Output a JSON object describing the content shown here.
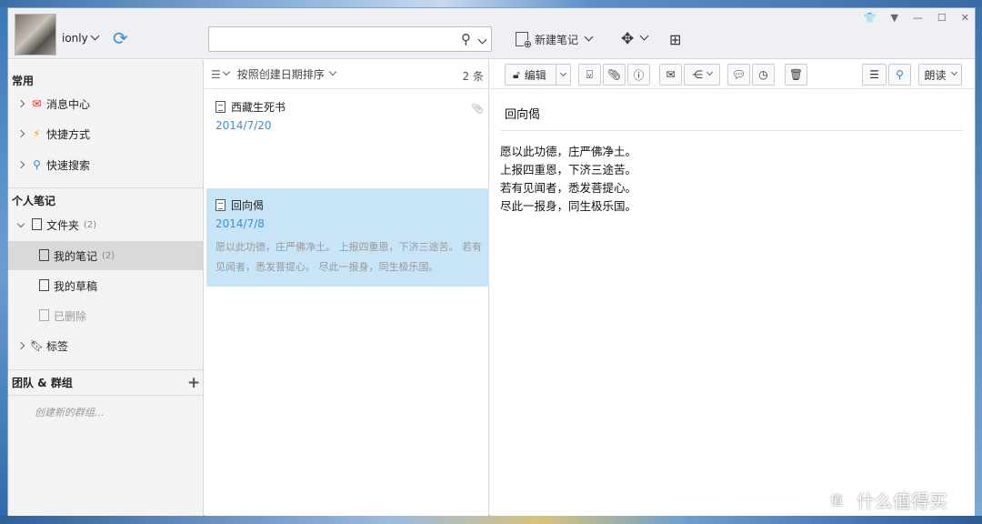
{
  "user": {
    "name": "ionly"
  },
  "toolbar": {
    "new_note_label": "新建笔记"
  },
  "search": {
    "placeholder": ""
  },
  "sidebar": {
    "common_label": "常用",
    "common_items": [
      {
        "label": "消息中心",
        "icon": "message-icon"
      },
      {
        "label": "快捷方式",
        "icon": "lightning-icon"
      },
      {
        "label": "快速搜索",
        "icon": "quick-search-icon"
      }
    ],
    "personal_label": "个人笔记",
    "folders_label": "文件夹",
    "folders_count": "(2)",
    "my_notes_label": "我的笔记",
    "my_notes_count": "(2)",
    "drafts_label": "我的草稿",
    "deleted_label": "已删除",
    "tags_label": "标签",
    "team_label": "团队 & 群组",
    "new_group_label": "创建新的群组..."
  },
  "list": {
    "sort_label": "按照创建日期排序",
    "count_label": "2 条",
    "notes": [
      {
        "title": "西藏生死书",
        "date": "2014/7/20",
        "snippet": ""
      },
      {
        "title": "回向偈",
        "date": "2014/7/8",
        "snippet": "愿以此功德，庄严佛净土。 上报四重恩，下济三途苦。 若有见闻者，悉发菩提心。 尽此一报身，同生极乐国。"
      }
    ]
  },
  "editor": {
    "edit_label": "编辑",
    "read_label": "朗读",
    "title": "回向偈",
    "lines": [
      "愿以此功德，庄严佛净土。",
      "上报四重恩，下济三途苦。",
      "若有见闻者，悉发菩提心。",
      "尽此一报身，同生极乐国。"
    ]
  },
  "watermark": {
    "text": "什么值得买",
    "icon_text": "值"
  },
  "colors": {
    "accent": "#3a8fd8",
    "selected_note_bg": "#c8e5f8",
    "sidebar_bg": "#f3f3f3",
    "titlebar_bg": "#eef0f3"
  }
}
